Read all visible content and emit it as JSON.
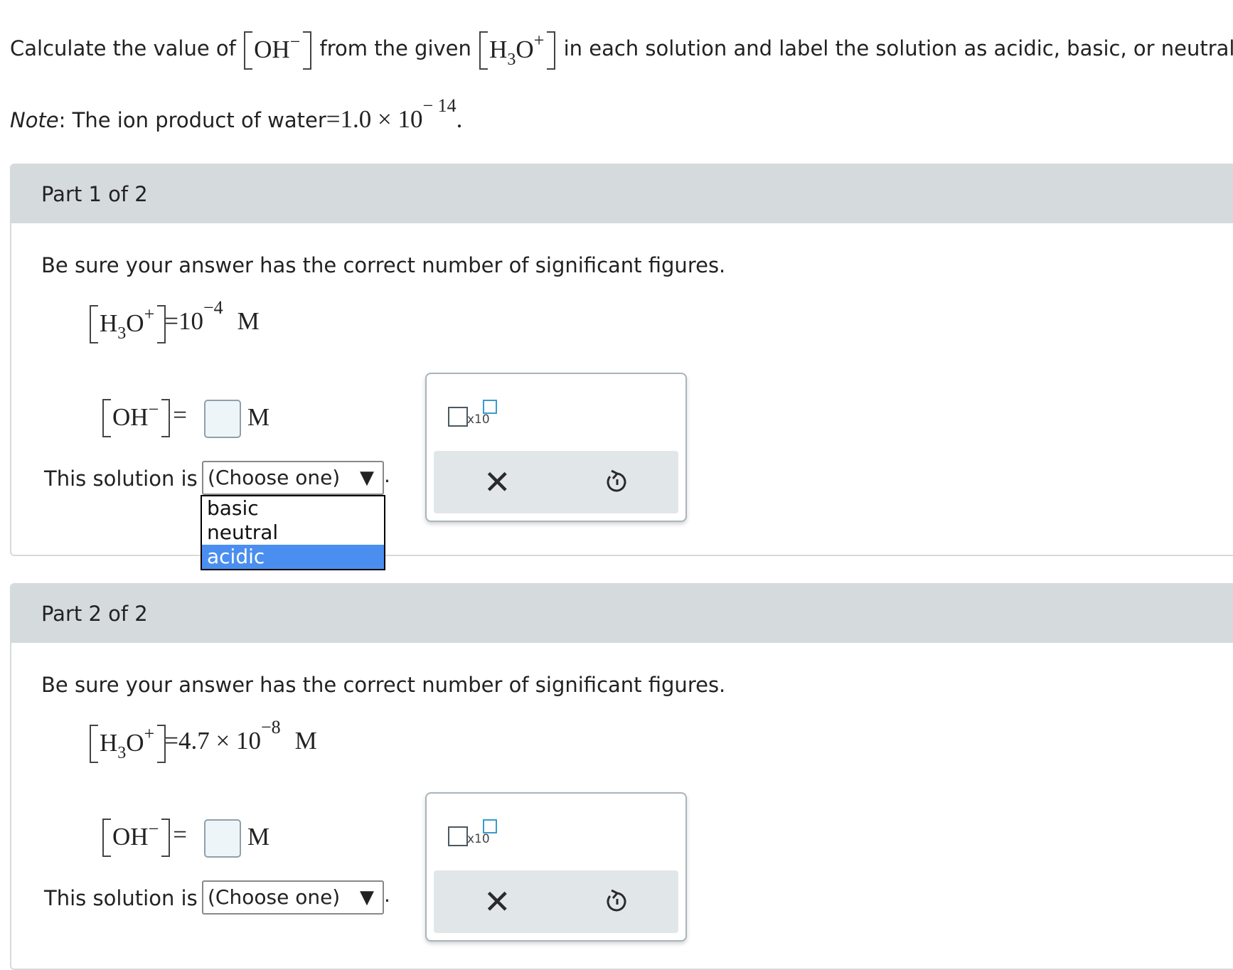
{
  "question": {
    "prefix": "Calculate the value of",
    "oh_species": "OH",
    "oh_charge": "−",
    "middle": "from the given",
    "h3o_H": "H",
    "h3o_sub": "3",
    "h3o_O": "O",
    "h3o_charge": "+",
    "suffix": "in each solution and label the solution as acidic, basic, or neutral."
  },
  "note": {
    "label": "Note",
    "text": ": The ion product of water",
    "equals": "=",
    "value": "1.0 × 10",
    "exponent": "− 14",
    "end": "."
  },
  "parts": [
    {
      "title": "Part 1 of 2",
      "instruction": "Be sure your answer has the correct number of significant figures.",
      "given_equals": "=",
      "given_value": "10",
      "given_exponent": "−4",
      "given_unit": "M",
      "answer_unit": "M",
      "solution_label": "This solution is",
      "select_value": "(Choose one)",
      "select_arrow": "▼",
      "select_period": ".",
      "dropdown_open": true,
      "dropdown_options": [
        "basic",
        "neutral",
        "acidic"
      ],
      "dropdown_highlighted": "acidic",
      "tool_x10": "x10",
      "close_symbol": "✕"
    },
    {
      "title": "Part 2 of 2",
      "instruction": "Be sure your answer has the correct number of significant figures.",
      "given_equals": "=",
      "given_value": "4.7 × 10",
      "given_exponent": "−8",
      "given_unit": "M",
      "answer_unit": "M",
      "solution_label": "This solution is",
      "select_value": "(Choose one)",
      "select_arrow": "▼",
      "select_period": ".",
      "dropdown_open": false,
      "tool_x10": "x10",
      "close_symbol": "✕"
    }
  ],
  "colors": {
    "header_bg": "#d5dadd",
    "highlight": "#4a8ff0",
    "answer_box_bg": "#eef5f8",
    "icon_blue": "#3a9ad0"
  }
}
